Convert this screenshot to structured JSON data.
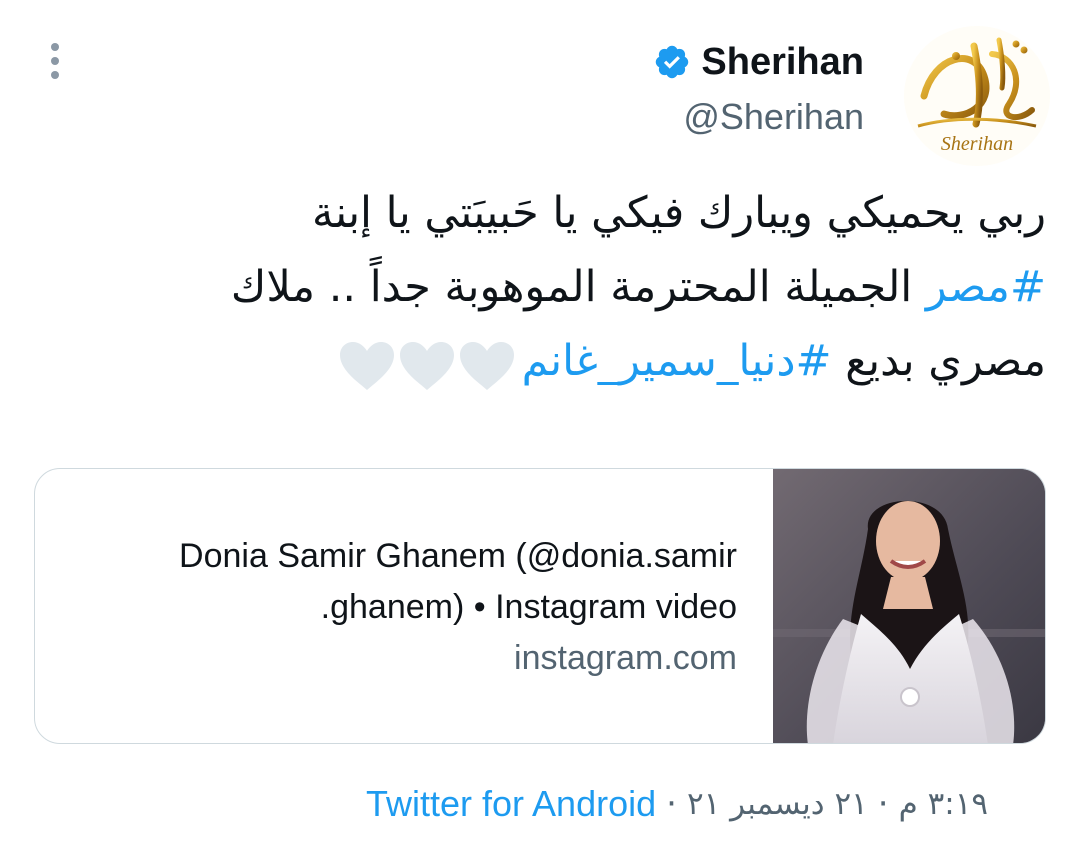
{
  "header": {
    "display_name": "Sherihan",
    "handle": "@Sherihan",
    "avatar_icon": "sherihan-calligraphy-logo",
    "avatar_logo_text": "Sherihan",
    "verified_icon": "verified-badge-icon",
    "more_icon": "more-vertical-icon"
  },
  "tweet": {
    "line1": "ربي يحميكي ويبارك فيكي يا حَبيبَتي يا إبنة",
    "line2_hashtag": "#مصر",
    "line2_text": " الجميلة المحترمة الموهوبة جداً .. ملاك",
    "line3_text": "مصري بديع ",
    "line3_hashtag": "#دنيا_سمير_غانم",
    "hearts": [
      "white-heart-icon",
      "white-heart-icon",
      "white-heart-icon"
    ]
  },
  "card": {
    "title_line1": "Donia Samir Ghanem (@donia.samir",
    "title_line2": ".ghanem) • Instagram video",
    "domain": "instagram.com",
    "image_desc": "woman in white dress smiling"
  },
  "footer": {
    "time": "٣:١٩ م",
    "dot1": "·",
    "date": "٢١ ديسمبر ٢١",
    "dot2": "·",
    "source": "Twitter for Android"
  },
  "colors": {
    "accent": "#1d9bf0",
    "text": "#0f1419",
    "secondary": "#536471",
    "heart": "#e1e8ed",
    "border": "#cfd9de"
  }
}
